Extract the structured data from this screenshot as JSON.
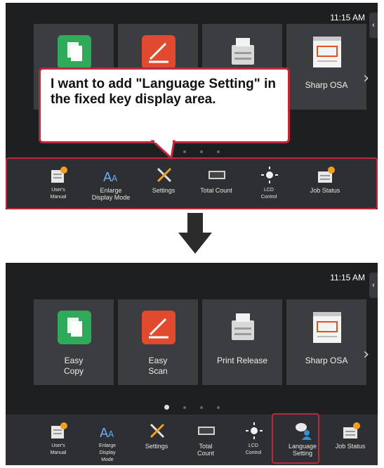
{
  "colors": {
    "screen_bg": "#1e1f21",
    "tile_bg": "#3c3d40",
    "keybar_bg": "#2e2f32",
    "highlight": "#c0273a",
    "copy_green": "#2faa5a",
    "scan_red": "#e04a2e",
    "badge_orange": "#f0a020"
  },
  "top": {
    "clock": "11:15 AM",
    "tiles": [
      {
        "label": "",
        "icon": "easy-copy-icon"
      },
      {
        "label": "",
        "icon": "easy-scan-icon"
      },
      {
        "label": "",
        "icon": "print-release-icon"
      },
      {
        "label": "Sharp OSA",
        "icon": "sharp-osa-icon"
      }
    ],
    "callout": "I want to add \"Language Setting\" in the fixed key display area.",
    "keys": [
      {
        "label": "User's\nManual",
        "icon": "users-manual-icon"
      },
      {
        "label": "Enlarge\nDisplay Mode",
        "icon": "enlarge-display-icon"
      },
      {
        "label": "Settings",
        "icon": "settings-icon"
      },
      {
        "label": "Total Count",
        "icon": "total-count-icon"
      },
      {
        "label": "LCD\nControl",
        "icon": "lcd-control-icon"
      },
      {
        "label": "Job Status",
        "icon": "job-status-icon"
      }
    ]
  },
  "bottom": {
    "clock": "11:15 AM",
    "tiles": [
      {
        "label": "Easy\nCopy",
        "icon": "easy-copy-icon"
      },
      {
        "label": "Easy\nScan",
        "icon": "easy-scan-icon"
      },
      {
        "label": "Print Release",
        "icon": "print-release-icon"
      },
      {
        "label": "Sharp OSA",
        "icon": "sharp-osa-icon"
      }
    ],
    "keys": [
      {
        "label": "User's\nManual",
        "icon": "users-manual-icon"
      },
      {
        "label": "Enlarge\nDisplay\nMode",
        "icon": "enlarge-display-icon"
      },
      {
        "label": "Settings",
        "icon": "settings-icon"
      },
      {
        "label": "Total\nCount",
        "icon": "total-count-icon"
      },
      {
        "label": "LCD\nControl",
        "icon": "lcd-control-icon"
      },
      {
        "label": "Language\nSetting",
        "icon": "language-setting-icon"
      },
      {
        "label": "Job Status",
        "icon": "job-status-icon"
      }
    ]
  },
  "arrows": {
    "next": "›",
    "side_tab": "‹"
  }
}
